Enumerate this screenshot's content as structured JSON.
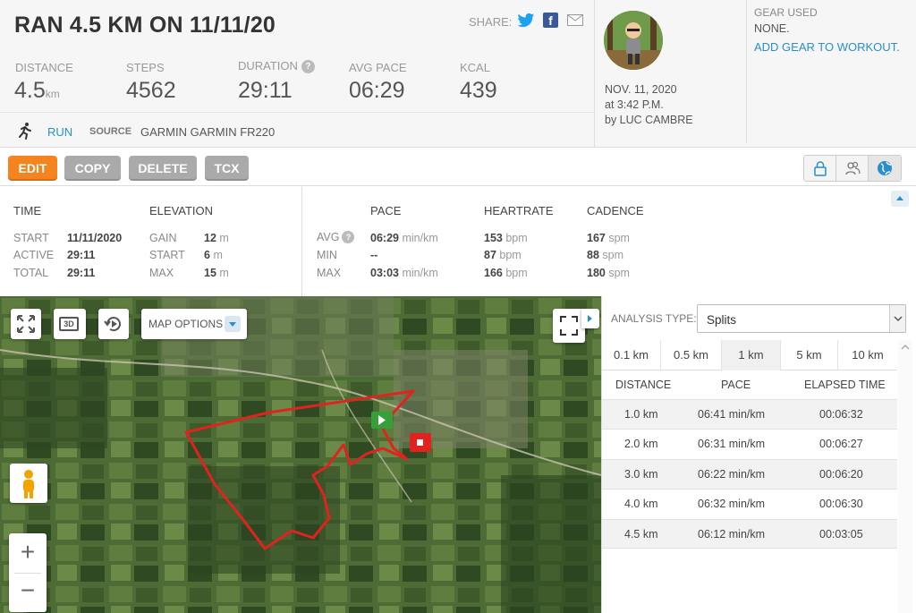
{
  "workout": {
    "title": "RAN 4.5 KM ON 11/11/20",
    "share_label": "SHARE:",
    "stats": [
      {
        "label": "DISTANCE",
        "value": "4.5",
        "unit": "km"
      },
      {
        "label": "STEPS",
        "value": "4562",
        "unit": ""
      },
      {
        "label": "DURATION",
        "value": "29:11",
        "unit": ""
      },
      {
        "label": "AVG PACE",
        "value": "06:29",
        "unit": ""
      },
      {
        "label": "KCAL",
        "value": "439",
        "unit": ""
      }
    ],
    "duration_help": "?",
    "activity_type": "RUN",
    "source_label": "SOURCE",
    "source_value": "GARMIN GARMIN FR220",
    "date_line1": "NOV. 11, 2020",
    "date_line2": "at 3:42 P.M.",
    "date_line3": "by LUC CAMBRE"
  },
  "gear": {
    "title": "GEAR USED",
    "value": "NONE.",
    "add_link": "ADD GEAR TO WORKOUT."
  },
  "toolbar": {
    "edit": "EDIT",
    "copy": "COPY",
    "delete": "DELETE",
    "tcx": "TCX"
  },
  "details": {
    "time_head": "TIME",
    "elevation_head": "ELEVATION",
    "pace_head": "PACE",
    "heartrate_head": "HEARTRATE",
    "cadence_head": "CADENCE",
    "time": [
      {
        "label": "START",
        "value": "11/11/2020"
      },
      {
        "label": "ACTIVE",
        "value": "29:11"
      },
      {
        "label": "TOTAL",
        "value": "29:11"
      }
    ],
    "elevation": [
      {
        "label": "GAIN",
        "value": "12",
        "unit": "m"
      },
      {
        "label": "START",
        "value": "6",
        "unit": "m"
      },
      {
        "label": "MAX",
        "value": "15",
        "unit": "m"
      }
    ],
    "row_labels": [
      "AVG",
      "MIN",
      "MAX"
    ],
    "avg_help": "?",
    "pace": [
      {
        "value": "06:29",
        "unit": "min/km"
      },
      {
        "value": "--",
        "unit": ""
      },
      {
        "value": "03:03",
        "unit": "min/km"
      }
    ],
    "heartrate": [
      {
        "value": "153",
        "unit": "bpm"
      },
      {
        "value": "87",
        "unit": "bpm"
      },
      {
        "value": "166",
        "unit": "bpm"
      }
    ],
    "cadence": [
      {
        "value": "167",
        "unit": "spm"
      },
      {
        "value": "88",
        "unit": "spm"
      },
      {
        "value": "180",
        "unit": "spm"
      }
    ]
  },
  "map": {
    "options_label": "MAP OPTIONS",
    "three_d_label": "3D",
    "zoom_in": "+",
    "zoom_out": "−",
    "route_color": "#e0231f",
    "start_marker_color": "#35a03a",
    "end_marker_color": "#e0231f"
  },
  "analysis": {
    "label": "ANALYSIS TYPE:",
    "selected": "Splits",
    "tabs": [
      "0.1 km",
      "0.5 km",
      "1 km",
      "5 km",
      "10 km"
    ],
    "active_tab": "1 km",
    "columns": [
      "DISTANCE",
      "PACE",
      "ELAPSED TIME"
    ],
    "rows": [
      {
        "distance": "1.0 km",
        "pace": "06:41 min/km",
        "elapsed": "00:06:32"
      },
      {
        "distance": "2.0 km",
        "pace": "06:31 min/km",
        "elapsed": "00:06:27"
      },
      {
        "distance": "3.0 km",
        "pace": "06:22 min/km",
        "elapsed": "00:06:20"
      },
      {
        "distance": "4.0 km",
        "pace": "06:32 min/km",
        "elapsed": "00:06:30"
      },
      {
        "distance": "4.5 km",
        "pace": "06:12 min/km",
        "elapsed": "00:03:05"
      }
    ]
  },
  "colors": {
    "accent": "#f5841f",
    "link": "#2a8fc8",
    "twitter": "#1da1f2",
    "facebook": "#3b5998"
  }
}
